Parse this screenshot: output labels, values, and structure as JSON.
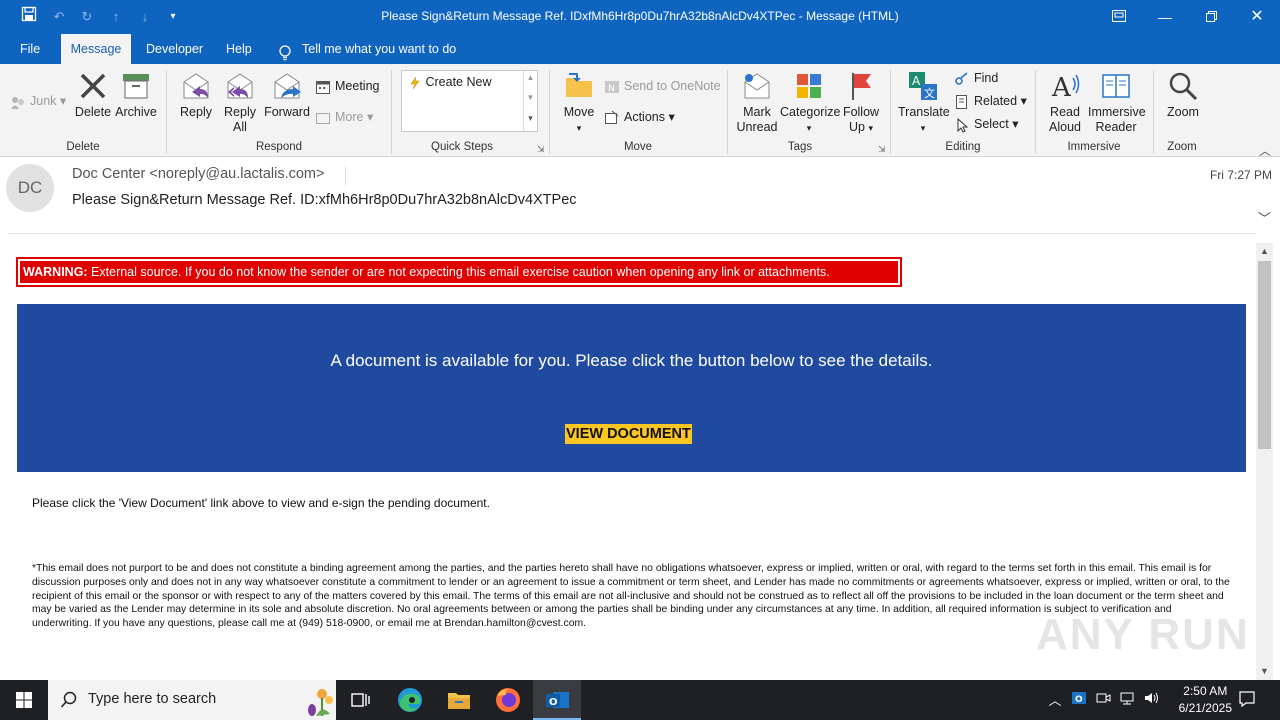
{
  "window": {
    "title": "Please Sign&Return Message Ref. IDxfMh6Hr8p0Du7hrA32b8nAlcDv4XTPec  -  Message (HTML)"
  },
  "tabs": [
    {
      "label": "File",
      "active": false
    },
    {
      "label": "Message",
      "active": true
    },
    {
      "label": "Developer",
      "active": false
    },
    {
      "label": "Help",
      "active": false
    }
  ],
  "tell_me": "Tell me what you want to do",
  "ribbon": {
    "delete_group": {
      "junk": "Junk",
      "delete": "Delete",
      "archive": "Archive",
      "label": "Delete"
    },
    "respond_group": {
      "reply": "Reply",
      "reply_all_1": "Reply",
      "reply_all_2": "All",
      "forward": "Forward",
      "meeting": "Meeting",
      "more": "More",
      "label": "Respond"
    },
    "quick_steps": {
      "create_new": "Create New",
      "label": "Quick Steps"
    },
    "move_group": {
      "move": "Move",
      "onenote": "Send to OneNote",
      "actions": "Actions",
      "label": "Move"
    },
    "tags_group": {
      "mark_unread_1": "Mark",
      "mark_unread_2": "Unread",
      "categorize": "Categorize",
      "follow_up_1": "Follow",
      "follow_up_2": "Up",
      "label": "Tags"
    },
    "editing_group": {
      "translate": "Translate",
      "find": "Find",
      "related": "Related",
      "select": "Select",
      "label": "Editing"
    },
    "immersive_group": {
      "read_aloud_1": "Read",
      "read_aloud_2": "Aloud",
      "immersive_reader_1": "Immersive",
      "immersive_reader_2": "Reader",
      "label": "Immersive"
    },
    "zoom_group": {
      "zoom": "Zoom",
      "label": "Zoom"
    }
  },
  "message": {
    "avatar_initials": "DC",
    "sender": "Doc Center <noreply@au.lactalis.com>",
    "subject": "Please Sign&Return Message Ref. ID:xfMh6Hr8p0Du7hrA32b8nAlcDv4XTPec",
    "date": "Fri 7:27 PM"
  },
  "body": {
    "warning_label": "WARNING:",
    "warning_text": " External source. If you do not know the sender or are not expecting this email exercise caution when opening any link or attachments.",
    "banner_text": "A document is available for you. Please click the button below to see the details.",
    "view_document": "VIEW DOCUMENT",
    "instruction": "Please click the 'View Document' link above to view and e-sign the pending document.",
    "disclaimer": "*This email does not purport to be and does not constitute a binding agreement among the parties, and the parties hereto shall have no obligations whatsoever, express or implied, written or oral, with regard to the terms set forth in this email. This email is for discussion purposes only and does not in any way whatsoever constitute a commitment to lender or an agreement to issue a commitment or term sheet, and Lender has made no commitments or agreements whatsoever, express or implied, written or oral, to the recipient of this email or the sponsor or with respect to any of the matters covered by this email. The terms of this email are not all-inclusive and should not be construed as to reflect all off the provisions to be included in the loan document or the term sheet and may be varied as the Lender may determine in its sole and absolute discretion. No oral agreements between or among the parties shall be binding under any circumstances at any time. In addition, all required information is subject to verification and underwriting. If you have any questions, please call me at (949) 518-0900, or email me at Brendan.hamilton@cvest.com."
  },
  "watermark": "ANY RUN",
  "taskbar": {
    "search_placeholder": "Type here to search",
    "time": "2:50 AM",
    "date": "6/21/2025"
  },
  "colors": {
    "titlebar": "#0f64c0",
    "banner": "#1f4aa0",
    "warning": "#e10000",
    "button": "#f9c624"
  }
}
